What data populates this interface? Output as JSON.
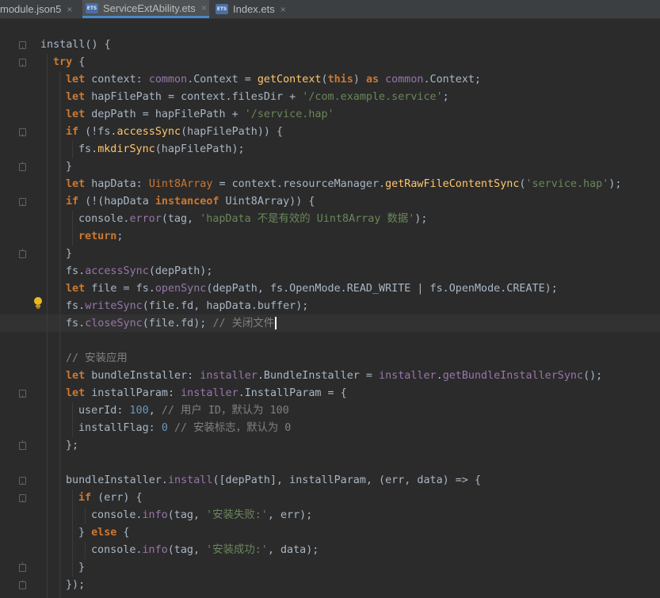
{
  "tabs": [
    {
      "label": "module.json5",
      "close": "×",
      "active": false
    },
    {
      "label": "ServiceExtAbility.ets",
      "close": "×",
      "active": true,
      "badge": "ETS"
    },
    {
      "label": "Index.ets",
      "close": "×",
      "active": false,
      "badge": "ETS"
    }
  ],
  "code": {
    "lines": [
      "install() {",
      "try {",
      "let context: common.Context = getContext(this) as common.Context;",
      "let hapFilePath = context.filesDir + '/com.example.service';",
      "let depPath = hapFilePath + '/service.hap'",
      "if (!fs.accessSync(hapFilePath)) {",
      "fs.mkdirSync(hapFilePath);",
      "}",
      "let hapData: Uint8Array = context.resourceManager.getRawFileContentSync('service.hap');",
      "if (!(hapData instanceof Uint8Array)) {",
      "console.error(tag, 'hapData 不是有效的 Uint8Array 数据');",
      "return;",
      "}",
      "fs.accessSync(depPath);",
      "let file = fs.openSync(depPath, fs.OpenMode.READ_WRITE | fs.OpenMode.CREATE);",
      "fs.writeSync(file.fd, hapData.buffer);",
      "fs.closeSync(file.fd); // 关闭文件",
      "",
      "// 安装应用",
      "let bundleInstaller: installer.BundleInstaller = installer.getBundleInstallerSync();",
      "let installParam: installer.InstallParam = {",
      "userId: 100, // 用户 ID，默认为 100",
      "installFlag: 0 // 安装标志，默认为 0",
      "};",
      "",
      "bundleInstaller.install([depPath], installParam, (err, data) => {",
      "if (err) {",
      "console.info(tag, '安装失败:', err);",
      "} else {",
      "console.info(tag, '安装成功:', data);",
      "}",
      "});"
    ]
  },
  "icons": {
    "bulb": "lightbulb-icon",
    "fold": "fold-marker-icon",
    "file_badge": "ets-file-icon"
  },
  "colors": {
    "background": "#2b2b2b",
    "keyword": "#cc7832",
    "string": "#6a8759",
    "number": "#6897bb",
    "function": "#ffc66d",
    "property": "#9876aa",
    "comment": "#808080",
    "text": "#a9b7c6",
    "tab_accent": "#4a88c7"
  }
}
